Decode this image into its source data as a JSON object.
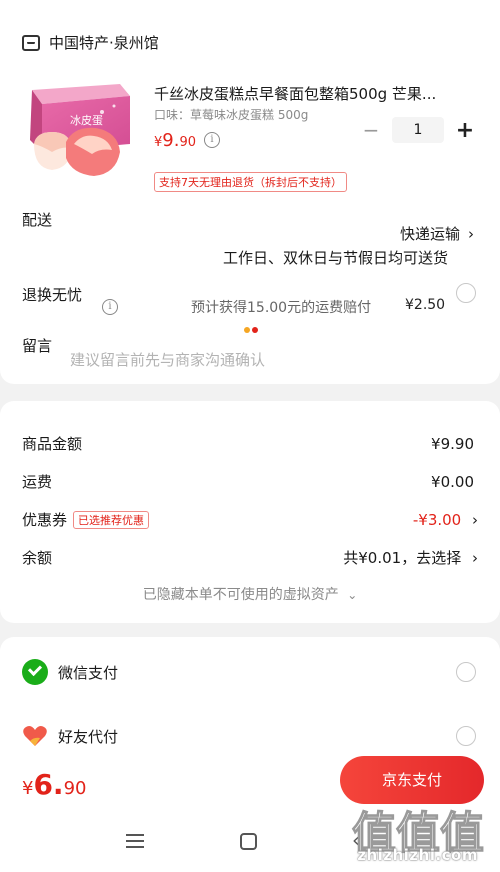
{
  "store": {
    "name": "中国特产·泉州馆",
    "icon": "store-icon"
  },
  "product": {
    "title": "千丝冰皮蛋糕点早餐面包整箱500g 芒果...",
    "spec": "口味：草莓味冰皮蛋糕 500g",
    "price_currency": "¥",
    "price_int": "9.",
    "price_dec": "90",
    "quantity": "1",
    "minus_label": "−",
    "plus_label": "+",
    "return_policy": "支持7天无理由退货（拆封后不支持）",
    "box_text": "冰皮蛋",
    "box_colors": [
      "#e86aa8",
      "#f3a7c9"
    ],
    "cake_color": "#f47b7b"
  },
  "delivery": {
    "label": "配送",
    "method": "快递运输",
    "time": "工作日、双休日与节假日均可送货"
  },
  "return_insurance": {
    "label": "退换无忧",
    "text": "预计获得15.00元的运费赔付",
    "price": "¥2.50",
    "selected": false
  },
  "message": {
    "label": "留言",
    "placeholder": "建议留言前先与商家沟通确认"
  },
  "pricing": {
    "goods_label": "商品金额",
    "goods_value": "¥9.90",
    "shipping_label": "运费",
    "shipping_value": "¥0.00",
    "coupon_label": "优惠券",
    "coupon_tag": "已选推荐优惠",
    "coupon_value": "-¥3.00",
    "balance_label": "余额",
    "balance_value": "共¥0.01，去选择",
    "hidden_note": "已隐藏本单不可使用的虚拟资产"
  },
  "payment_methods": [
    {
      "label": "微信支付",
      "icon": "wechat-icon",
      "selected": false
    },
    {
      "label": "好友代付",
      "icon": "heart-icon",
      "selected": false
    }
  ],
  "footer": {
    "total_currency": "¥",
    "total_int": "6.",
    "total_dec": "90",
    "pay_button": "京东支付"
  },
  "watermark": {
    "text": "zhizhizhi.com",
    "glyphs": "值值值"
  },
  "colors": {
    "accent": "#e2231a",
    "wechat": "#1aad19"
  }
}
